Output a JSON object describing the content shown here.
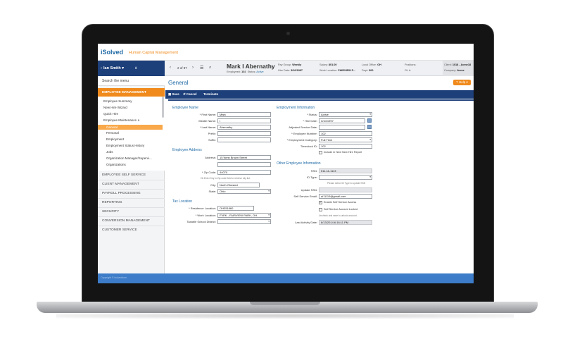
{
  "app": {
    "logo": "iSolved",
    "subtitle": "Human Capital Management"
  },
  "user": {
    "name": "Ian Smith ▾"
  },
  "nav": {
    "count": "2 of 97"
  },
  "employee": {
    "name": "Mark I Abernathy",
    "employee_label": "Employee#:",
    "employee_num": "102",
    "status_label": "Status:",
    "status": "Active",
    "pay_group_label": "Pay Group:",
    "pay_group": "Weekly",
    "hire_date_label": "Hire Date:",
    "hire_date": "3/10/1997",
    "salary_label": "Salary:",
    "salary": "801.00",
    "work_location_label": "Work Location:",
    "work_location": "FAIRVIEW P...",
    "local_office_label": "Local Office:",
    "local_office": "OH",
    "dept_label": "Dept:",
    "dept": "300",
    "positions_label": "Positions:",
    "positions": "",
    "gl_label": "GL #:",
    "gl": "",
    "client_label": "Client:",
    "client": "1018 - Acme18",
    "company_label": "Company:",
    "company": "Acme"
  },
  "sidebar": {
    "search": "Search the menu",
    "section": "EMPLOYEE MANAGEMENT",
    "sub_items": [
      "Employee Summary",
      "New Hire Wizard",
      "Quick Hire",
      "Employee Maintenance ∧"
    ],
    "maint_items": [
      "General",
      "Personal",
      "Employment",
      "Employment Status History",
      "Jobs",
      "Organization Manager/Supervi...",
      "Organizations"
    ],
    "main_items": [
      "EMPLOYEE SELF SERVICE",
      "CLIENT MANAGEMENT",
      "PAYROLL PROCESSING",
      "REPORTING",
      "SECURITY",
      "CONVERSION MANAGEMENT",
      "CUSTOMER SERVICE"
    ]
  },
  "page": {
    "title": "General",
    "help": "? Help ▾"
  },
  "toolbar": {
    "save": "Save",
    "cancel": "Cancel",
    "terminate": "Terminate"
  },
  "employee_name": {
    "title": "Employee Name",
    "first_label": "* First Name:",
    "first": "Mark",
    "middle_label": "Middle Name:",
    "middle": "I",
    "last_label": "* Last Name:",
    "last": "Abernathy",
    "prefix_label": "Prefix:",
    "prefix": "",
    "suffix_label": "Suffix:",
    "suffix": ""
  },
  "address": {
    "title": "Employee Address",
    "address_label": "Address:",
    "address1": "15 West Brown Street",
    "address2": "",
    "zip_label": "* Zip Code:",
    "zip": "44070",
    "zip_hint": "Hit Enter Key in Zip code field to retrieve city list.",
    "city_label": "City:",
    "city": "North Olmsted",
    "state_label": "State:",
    "state": "Ohio"
  },
  "tax": {
    "title": "Tax Location",
    "residence_label": "* Residence Location:",
    "residence": "OH351860",
    "work_label": "* Work Location:",
    "work": "FVPK - FAIRVIEW PARK, OH",
    "school_label": "Taxable School District:",
    "school": ""
  },
  "employment": {
    "title": "Employment Information",
    "status_label": "* Status:",
    "status": "Active",
    "hire_label": "* Hire Date:",
    "hire": "3/10/1997",
    "adjusted_label": "Adjusted Service Date:",
    "adjusted": "",
    "number_label": "* Employee Number:",
    "number": "102",
    "category_label": "* Employment Category:",
    "category": "Full Time",
    "timeclock_label": "Timeclock ID:",
    "timeclock": "102",
    "include_label": "Include in Next New Hire Report"
  },
  "other": {
    "title": "Other Employee Information",
    "ssn_label": "SSN:",
    "ssn": "511-11-1113",
    "idtype_label": "ID Type:",
    "idtype": "",
    "ssn_hint": "Please select ID Type to update SSN",
    "update_label": "Update SSN:",
    "update": "",
    "email_label": "Self Service Email:",
    "email": "ai11119@gmail.com",
    "enable_label": "Enable Self Service Access",
    "locked_label": "Self Service Account Locked",
    "unlock_hint": "Uncheck and save to unlock account.",
    "activity_label": "Last Activity Date:",
    "activity": "8/13/2014 6:16:11 PM"
  },
  "footer": {
    "text": "Copyright © isolvedhcm"
  },
  "colors": {
    "navy": "#1d3f7a",
    "orange": "#f08a1c",
    "blue": "#1f6aa5",
    "footer": "#3d7cc8"
  }
}
